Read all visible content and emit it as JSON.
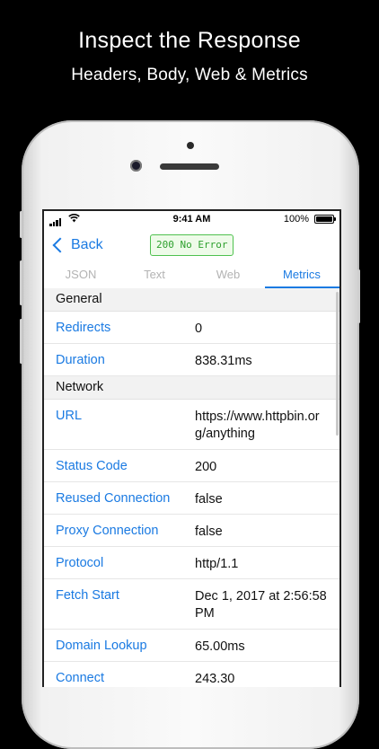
{
  "promo": {
    "title": "Inspect the Response",
    "subtitle": "Headers, Body, Web & Metrics"
  },
  "status_bar": {
    "time": "9:41 AM",
    "battery": "100%"
  },
  "nav": {
    "back_label": "Back",
    "status": "200 No Error"
  },
  "tabs": [
    {
      "label": "JSON"
    },
    {
      "label": "Text"
    },
    {
      "label": "Web"
    },
    {
      "label": "Metrics"
    }
  ],
  "active_tab": "Metrics",
  "sections": {
    "general": {
      "title": "General",
      "rows": [
        {
          "key": "Redirects",
          "value": "0"
        },
        {
          "key": "Duration",
          "value": "838.31ms"
        }
      ]
    },
    "network": {
      "title": "Network",
      "rows": [
        {
          "key": "URL",
          "value": "https://www.httpbin.org/anything"
        },
        {
          "key": "Status Code",
          "value": "200"
        },
        {
          "key": "Reused Connection",
          "value": "false"
        },
        {
          "key": "Proxy Connection",
          "value": "false"
        },
        {
          "key": "Protocol",
          "value": "http/1.1"
        },
        {
          "key": "Fetch Start",
          "value": "Dec 1, 2017 at 2:56:58 PM"
        },
        {
          "key": "Domain Lookup",
          "value": "65.00ms"
        },
        {
          "key": "Connect",
          "value": "243.30"
        }
      ]
    }
  },
  "colors": {
    "accent": "#1a7ae2",
    "status_green": "#2ea02e",
    "section_bg": "#f2f2f2"
  }
}
